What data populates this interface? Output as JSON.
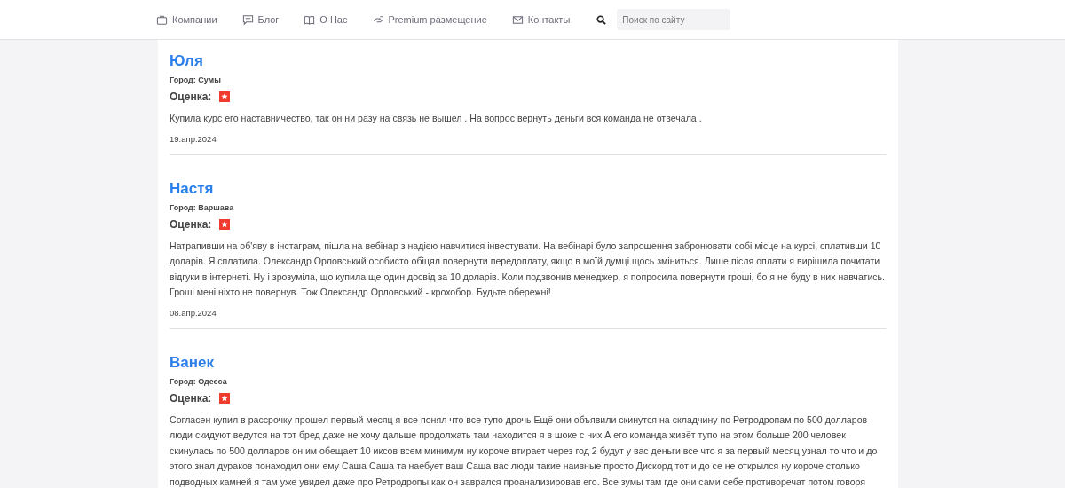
{
  "nav": {
    "items": [
      {
        "label": "Компании"
      },
      {
        "label": "Блог"
      },
      {
        "label": "О Нас"
      },
      {
        "label": "Premium размещение"
      },
      {
        "label": "Контакты"
      }
    ],
    "search": {
      "placeholder": "Поиск по сайту"
    }
  },
  "reviews": [
    {
      "name": "Юля",
      "city": "Город: Сумы",
      "rating_label": "Оценка:",
      "text": "Купила курс его наставничество, так он ни разу на связь не вышел . На вопрос вернуть деньги вся команда не отвечала .",
      "date": "19.апр.2024"
    },
    {
      "name": "Настя",
      "city": "Город: Варшава",
      "rating_label": "Оценка:",
      "text": "Натрапивши на об'яву в інстаграм, пішла на вебінар з надією навчитися інвестувати. На вебінарі було запрошення забронювати собі місце на курсі, сплативши 10 доларів. Я сплатила. Олександр Орловський особисто обіцял повернути передоплату, якщо в моїй думці щось зміниться. Лише після оплати я вирішила почитати відгуки в інтернеті. Ну і зрозуміла, що купила ще один досвід за 10 доларів. Коли подзвонив менеджер, я попросила повернути гроші, бо я не буду в них навчатись. Гроші мені ніхто не повернув. Тож Олександр Орловський - крохобор. Будьте обережні!",
      "date": "08.апр.2024"
    },
    {
      "name": "Ванек",
      "city": "Город: Одесса",
      "rating_label": "Оценка:",
      "text": "Согласен купил в рассрочку прошел первый месяц я все понял что все тупо дрочь Ещё они объявили скинутся на складчину по Ретродропам по 500 долларов люди скидуют ведутся на тот бред даже не хочу дальше продолжать там находится я в шоке с них А его команда живёт тупо на этом больше 200 человек скинулась по 500 долларов он им обещает 10 иксов всем минимум ну короче втирает через год 2 будут у вас деньги все что я за первый месяц узнал то что и до этого знал дураков понаходил они ему Саша Саша та наебует ваш Саша вас люди такие наивные просто Дискорд тот и до се не открылся ну короче столько подводных камней я там уже увидел даже про Ретродропы как он заврался проанализировав его. Все зумы там где они сами себе противоречат потом говоря"
    }
  ]
}
